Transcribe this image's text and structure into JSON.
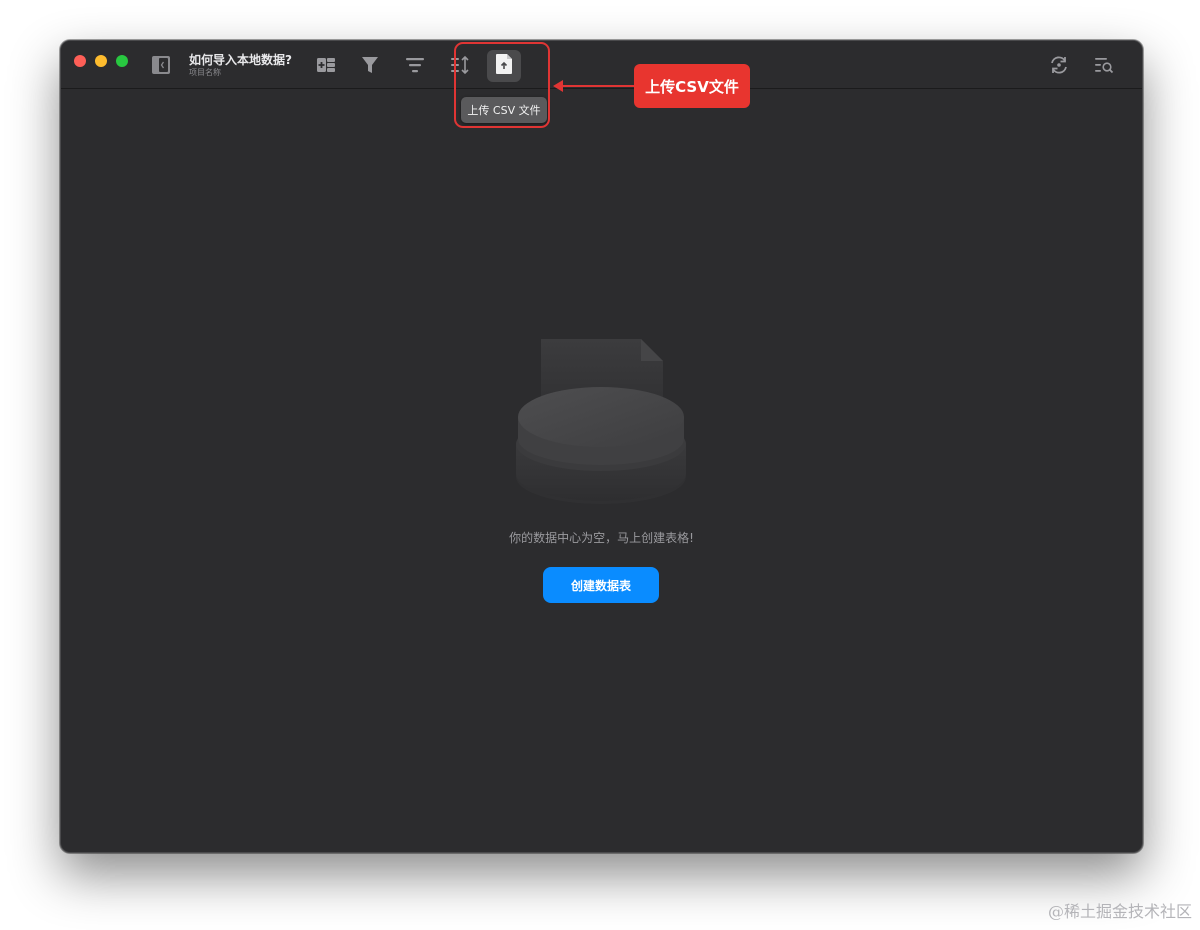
{
  "window": {
    "title": "如何导入本地数据?",
    "subtitle": "项目名称"
  },
  "toolbar": {
    "icons": [
      "sidebar-toggle-icon",
      "add-table-icon",
      "filter-icon",
      "sort-icon",
      "row-height-icon",
      "upload-csv-icon",
      "sync-icon",
      "search-icon"
    ],
    "upload_tooltip": "上传 CSV 文件"
  },
  "annotation": {
    "callout_label": "上传CSV文件",
    "color": "#e8352f"
  },
  "empty_state": {
    "message": "你的数据中心为空，马上创建表格!",
    "button_label": "创建数据表",
    "button_color": "#0a8cff"
  },
  "watermark": "@稀土掘金技术社区"
}
